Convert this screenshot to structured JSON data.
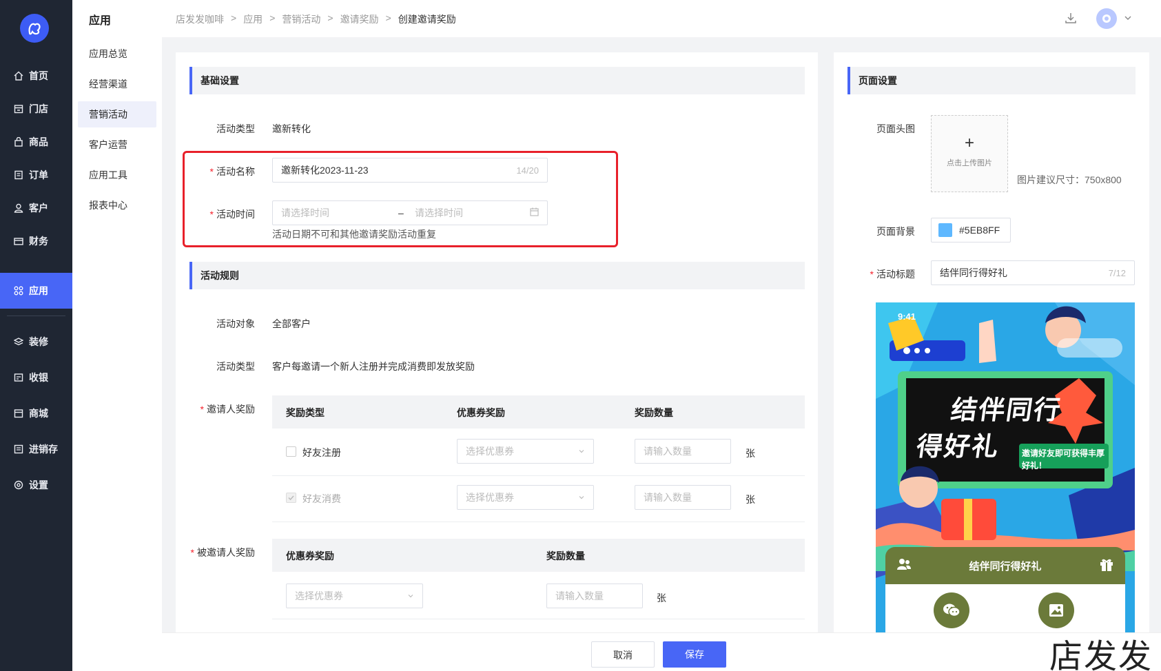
{
  "sidebar": {
    "items": [
      {
        "label": "首页",
        "icon": "home-icon"
      },
      {
        "label": "门店",
        "icon": "store-icon"
      },
      {
        "label": "商品",
        "icon": "bag-icon"
      },
      {
        "label": "订单",
        "icon": "order-icon"
      },
      {
        "label": "客户",
        "icon": "user-icon"
      },
      {
        "label": "财务",
        "icon": "wallet-icon"
      },
      {
        "label": "应用",
        "icon": "apps-icon"
      },
      {
        "label": "装修",
        "icon": "layers-icon"
      },
      {
        "label": "收银",
        "icon": "cashier-icon"
      },
      {
        "label": "商城",
        "icon": "mall-icon"
      },
      {
        "label": "进销存",
        "icon": "inventory-icon"
      },
      {
        "label": "设置",
        "icon": "settings-icon"
      }
    ]
  },
  "submenu": {
    "title": "应用",
    "items": [
      "应用总览",
      "经营渠道",
      "营销活动",
      "客户运营",
      "应用工具",
      "报表中心"
    ]
  },
  "breadcrumb": [
    "店发发咖啡",
    ">",
    "应用",
    ">",
    "营销活动",
    ">",
    "邀请奖励",
    ">",
    "创建邀请奖励"
  ],
  "basic": {
    "section": "基础设置",
    "type_label": "活动类型",
    "type_value": "邀新转化",
    "name_label": "活动名称",
    "name_value": "邀新转化2023-11-23",
    "name_count": "14/20",
    "time_label": "活动时间",
    "time_start_ph": "请选择时间",
    "time_sep": "–",
    "time_end_ph": "请选择时间",
    "time_hint": "活动日期不可和其他邀请奖励活动重复"
  },
  "rules": {
    "section": "活动规则",
    "target_label": "活动对象",
    "target_value": "全部客户",
    "type_label": "活动类型",
    "type_value": "客户每邀请一个新人注册并完成消费即发放奖励",
    "inviter_label": "邀请人奖励",
    "inviter_headers": [
      "奖励类型",
      "优惠券奖励",
      "奖励数量"
    ],
    "inviter_rows": [
      {
        "type": "好友注册",
        "coupon_ph": "选择优惠券",
        "qty_ph": "请输入数量",
        "unit": "张"
      },
      {
        "type": "好友消费",
        "coupon_ph": "选择优惠券",
        "qty_ph": "请输入数量",
        "unit": "张"
      }
    ],
    "invitee_label": "被邀请人奖励",
    "invitee_headers": [
      "优惠券奖励",
      "奖励数量"
    ],
    "invitee_row": {
      "coupon_ph": "选择优惠券",
      "qty_ph": "请输入数量",
      "unit": "张"
    }
  },
  "page": {
    "section": "页面设置",
    "header_label": "页面头图",
    "upload_plus": "+",
    "upload_text": "点击上传图片",
    "size_hint": "图片建议尺寸：750x800",
    "bg_label": "页面背景",
    "bg_value": "#5EB8FF",
    "bg_color": "#5EB8FF",
    "title_label": "活动标题",
    "title_value": "结伴同行得好礼",
    "title_count": "7/12"
  },
  "preview": {
    "time": "9:41",
    "headline1": "结伴同行",
    "headline2": "得好礼",
    "bubble": "邀请好友即可获得丰厚好礼！",
    "card_title": "结伴同行得好礼",
    "card_color": "#6b7a3a"
  },
  "footer": {
    "cancel": "取消",
    "save": "保存"
  },
  "watermark": "店发发",
  "accent": "#4866f6"
}
